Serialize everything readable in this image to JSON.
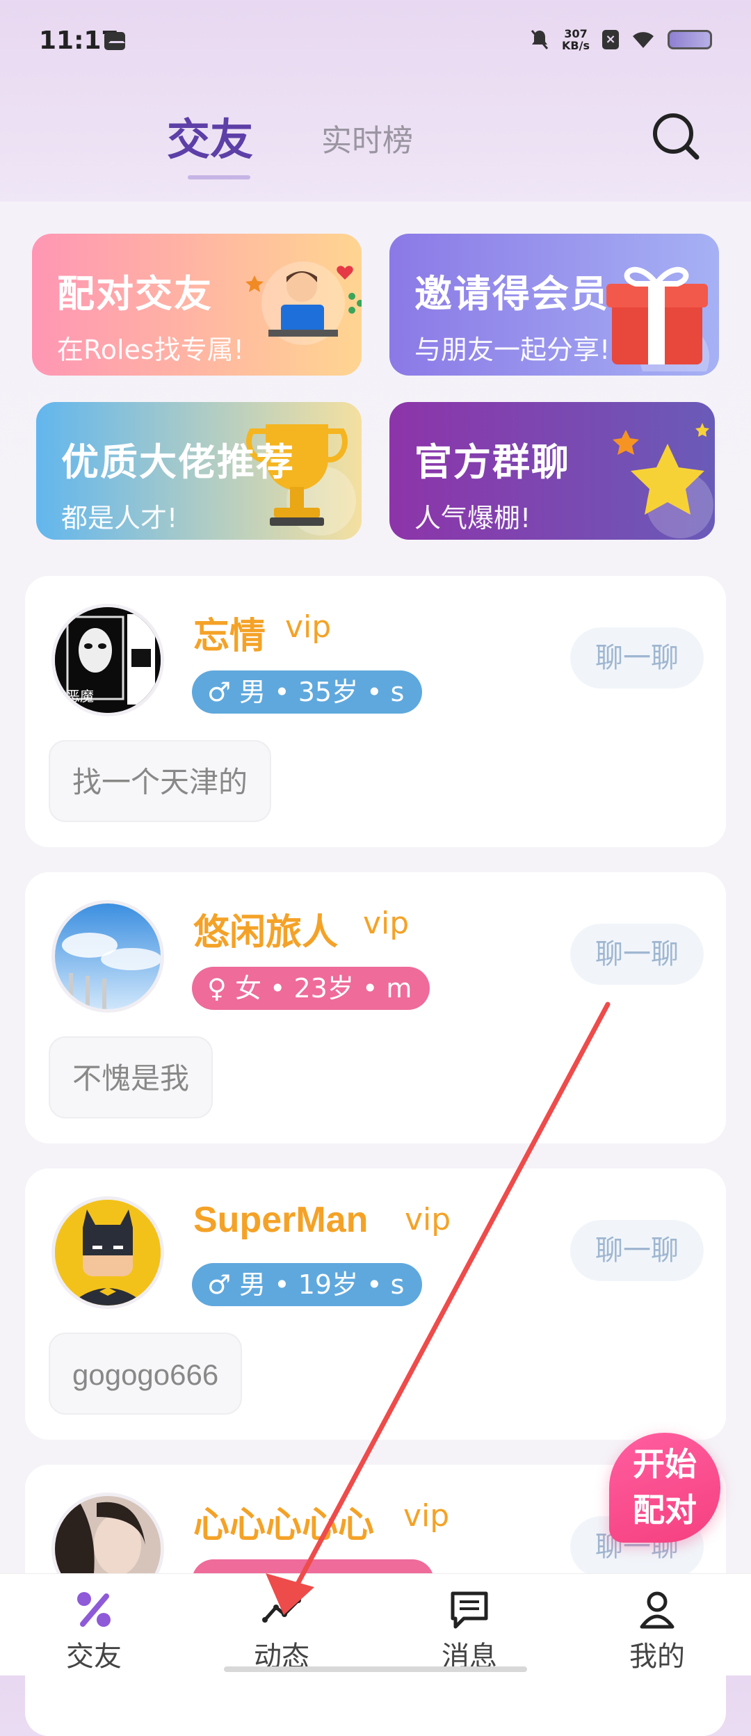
{
  "status_bar": {
    "time": "11:17",
    "speed_value": "307",
    "speed_unit": "KB/s"
  },
  "header": {
    "tab_active": "交友",
    "tab_other": "实时榜"
  },
  "feature_cards": [
    {
      "title": "配对交友",
      "subtitle": "在Roles找专属!"
    },
    {
      "title": "邀请得会员",
      "subtitle": "与朋友一起分享!"
    },
    {
      "title": "优质大佬推荐",
      "subtitle": "都是人才!"
    },
    {
      "title": "官方群聊",
      "subtitle": "人气爆棚!"
    }
  ],
  "users": [
    {
      "name": "忘情",
      "vip": "vip",
      "gender_icon": "♂",
      "info": "男 • 35岁 • s",
      "chat": "聊一聊",
      "intro": "找一个天津的",
      "avatar_text": "恶魔"
    },
    {
      "name": "悠闲旅人",
      "vip": "vip",
      "gender_icon": "♀",
      "info": "女 • 23岁 • m",
      "chat": "聊一聊",
      "intro": "不愧是我"
    },
    {
      "name": "SuperMan",
      "vip": "vip",
      "gender_icon": "♂",
      "info": "男 • 19岁 • s",
      "chat": "聊一聊",
      "intro": "gogogo666"
    },
    {
      "name": "心心心心心",
      "vip": "vip",
      "chat": "聊一聊"
    }
  ],
  "match_button": {
    "line1": "开始",
    "line2": "配对"
  },
  "nav": [
    {
      "label": "交友"
    },
    {
      "label": "动态"
    },
    {
      "label": "消息"
    },
    {
      "label": "我的"
    }
  ],
  "colors": {
    "accent": "#5d3fa7",
    "name": "#f4a227",
    "male": "#5fa8dd",
    "female": "#ee6b9a",
    "match": "#f5407f"
  }
}
